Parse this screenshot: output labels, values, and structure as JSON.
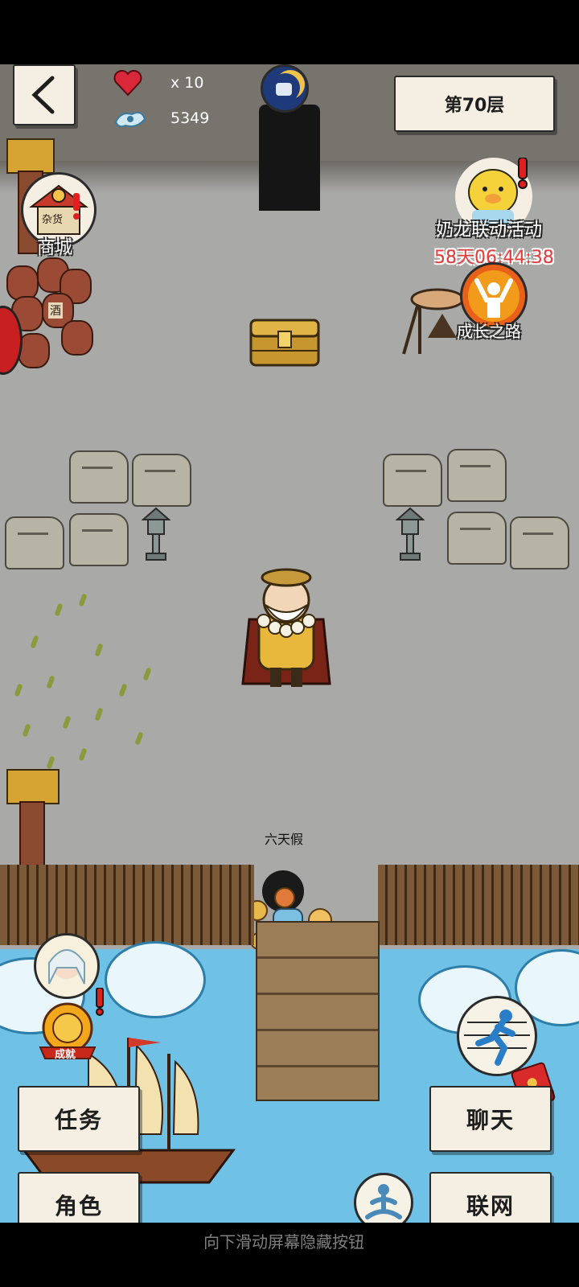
{
  "hud": {
    "back_icon": "back-chevron-icon",
    "heart_icon": "heart-icon",
    "lives_text": "x 10",
    "currency_icon": "cloud-spirit-icon",
    "currency_value": "5349",
    "floor_label": "第70层"
  },
  "left_menu": {
    "shop_label": "商城",
    "shop_sign": "杂货",
    "achievement_badge": "成就"
  },
  "right_menu": {
    "event_label": "奶龙联动活动",
    "event_timer": "58天06:44:38",
    "growth_label": "成长之路"
  },
  "scene": {
    "player_name": "六天假",
    "wine_jar_text": "酒"
  },
  "buttons": {
    "task": "任务",
    "character": "角色",
    "chat": "聊天",
    "network": "联网"
  },
  "hint_text": "向下滑动屏幕隐藏按钮",
  "colors": {
    "ground": "#a9a9a8",
    "sea": "#6fc1e6",
    "panel": "#f4efe2",
    "timer_red": "#e63b3b"
  }
}
